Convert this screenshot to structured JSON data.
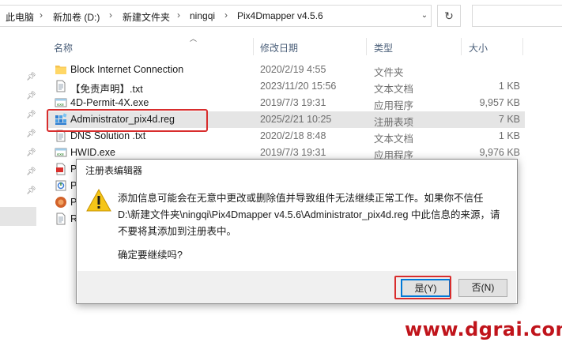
{
  "breadcrumb": {
    "items": [
      "此电脑",
      "新加卷 (D:)",
      "新建文件夹",
      "ningqi",
      "Pix4Dmapper v4.5.6"
    ],
    "separator": "›"
  },
  "address_bar": {
    "dropdown_glyph": "⌄",
    "refresh_glyph": "↻"
  },
  "columns": {
    "name": "名称",
    "modified": "修改日期",
    "type": "类型",
    "size": "大小"
  },
  "files": [
    {
      "name": "Block Internet Connection",
      "modified": "2020/2/19 4:55",
      "type": "文件夹",
      "size": "",
      "icon": "folder-icon"
    },
    {
      "name": "【免责声明】.txt",
      "modified": "2023/11/20 15:56",
      "type": "文本文档",
      "size": "1 KB",
      "icon": "text-file-icon"
    },
    {
      "name": "4D-Permit-4X.exe",
      "modified": "2019/7/3 19:31",
      "type": "应用程序",
      "size": "9,957 KB",
      "icon": "exe-icon"
    },
    {
      "name": "Administrator_pix4d.reg",
      "modified": "2025/2/21 10:25",
      "type": "注册表项",
      "size": "7 KB",
      "icon": "registry-file-icon",
      "selected": true
    },
    {
      "name": "DNS Solution .txt",
      "modified": "2020/2/18 8:48",
      "type": "文本文档",
      "size": "1 KB",
      "icon": "text-file-icon"
    },
    {
      "name": "HWID.exe",
      "modified": "2019/7/3 19:31",
      "type": "应用程序",
      "size": "9,976 KB",
      "icon": "exe-icon"
    },
    {
      "name": "P",
      "modified": "",
      "type": "",
      "size": "",
      "icon": "pdf-icon"
    },
    {
      "name": "P",
      "modified": "",
      "type": "",
      "size": "",
      "icon": "installer-icon"
    },
    {
      "name": "P",
      "modified": "",
      "type": "",
      "size": "",
      "icon": "app-icon"
    },
    {
      "name": "R",
      "modified": "",
      "type": "",
      "size": "",
      "icon": "text-file-icon"
    }
  ],
  "dialog": {
    "title": "注册表编辑器",
    "message": "添加信息可能会在无意中更改或删除值并导致组件无法继续正常工作。如果你不信任 D:\\新建文件夹\\ningqi\\Pix4Dmapper v4.5.6\\Administrator_pix4d.reg 中此信息的来源，请不要将其添加到注册表中。",
    "confirm": "确定要继续吗?",
    "yes_label": "是(Y)",
    "no_label": "否(N)",
    "icon": "warning-icon"
  },
  "watermark": "www.dgrai.com",
  "colors": {
    "highlight": "#d82d2d",
    "watermark": "#c0141b",
    "selection": "#e5e5e5",
    "default_button_border": "#0078d7"
  }
}
